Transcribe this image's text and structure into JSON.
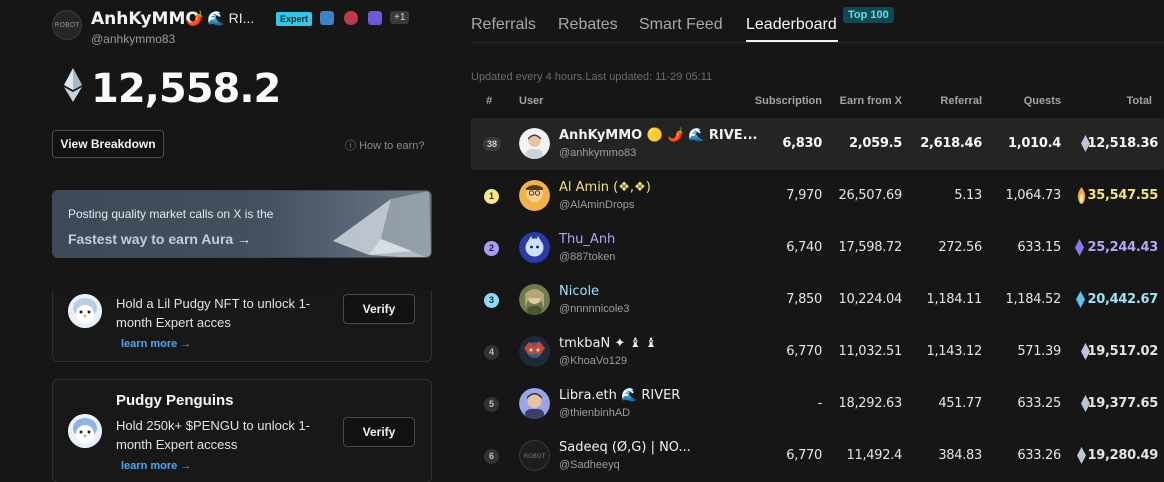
{
  "profile": {
    "avatar_text": "ROBOT",
    "name": "AnhKyMMO",
    "name_suffix": "🌶️ 🌊 RI...",
    "expert_badge": "Expert",
    "extra_count": "+1",
    "handle": "@anhkymmo83",
    "balance": "12,558.2",
    "view_breakdown": "View Breakdown",
    "how_to_earn": "How to earn?"
  },
  "promo": {
    "line1": "Posting quality market calls on X is the",
    "line2": "Fastest way to earn Aura",
    "arrow": "→"
  },
  "cards": [
    {
      "title": "",
      "text": "Hold a Lil Pudgy NFT to unlock 1-month Expert acces",
      "learn_more": "learn more →",
      "button": "Verify"
    },
    {
      "title": "Pudgy Penguins",
      "text": "Hold 250k+ $PENGU to unlock 1-month Expert access",
      "learn_more": "learn more →",
      "button": "Verify"
    }
  ],
  "tabs": [
    "Referrals",
    "Rebates",
    "Smart Feed",
    "Leaderboard"
  ],
  "active_tab": "Leaderboard",
  "top_badge": "Top 100",
  "updated_text": "Updated every 4 hours.Last updated: 11-29 05:11",
  "table": {
    "headers": [
      "#",
      "User",
      "Subscription",
      "Earn from X",
      "Referral",
      "Quests",
      "Total"
    ],
    "rows": [
      {
        "rank": "38",
        "name": "AnhKyMMO 🟡 🌶️ 🌊 RIVE...",
        "handle": "@anhkymmo83",
        "subscription": "6,830",
        "earn": "2,059.5",
        "referral": "2,618.46",
        "quests": "1,010.4",
        "total": "12,518.36",
        "icon_color": "#b9c6d6"
      },
      {
        "rank": "1",
        "name": "Al Amin (❖,❖)",
        "handle": "@AlAminDrops",
        "subscription": "7,970",
        "earn": "26,507.69",
        "referral": "5.13",
        "quests": "1,064.73",
        "total": "35,547.55",
        "icon_color": "#f2a64a",
        "name_color": "#f4e37a",
        "total_color": "#f4e37a"
      },
      {
        "rank": "2",
        "name": "Thu_Anh",
        "handle": "@887token",
        "subscription": "6,740",
        "earn": "17,598.72",
        "referral": "272.56",
        "quests": "633.15",
        "total": "25,244.43",
        "icon_color": "#8b78ef",
        "name_color": "#b3a6f6",
        "total_color": "#b3a6f6"
      },
      {
        "rank": "3",
        "name": "Nicole",
        "handle": "@nnnnnicole3",
        "subscription": "7,850",
        "earn": "10,224.04",
        "referral": "1,184.11",
        "quests": "1,184.52",
        "total": "20,442.67",
        "icon_color": "#57c7ef",
        "name_color": "#9fe2f8",
        "total_color": "#9fe2f8"
      },
      {
        "rank": "4",
        "name": "tmkbaN ✦ ♝ ♝",
        "handle": "@KhoaVo129",
        "subscription": "6,770",
        "earn": "11,032.51",
        "referral": "1,143.12",
        "quests": "571.39",
        "total": "19,517.02",
        "icon_color": "#b9c6d6"
      },
      {
        "rank": "5",
        "name": "Libra.eth 🌊 RIVER",
        "handle": "@thienbinhAD",
        "subscription": "-",
        "earn": "18,292.63",
        "referral": "451.77",
        "quests": "633.25",
        "total": "19,377.65",
        "icon_color": "#b9c6d6"
      },
      {
        "rank": "6",
        "name": "Sadeeq (Ø,G) | NO...",
        "handle": "@Sadheeyq",
        "subscription": "6,770",
        "earn": "11,492.4",
        "referral": "384.83",
        "quests": "633.26",
        "total": "19,280.49",
        "icon_color": "#b9c6d6"
      }
    ]
  }
}
